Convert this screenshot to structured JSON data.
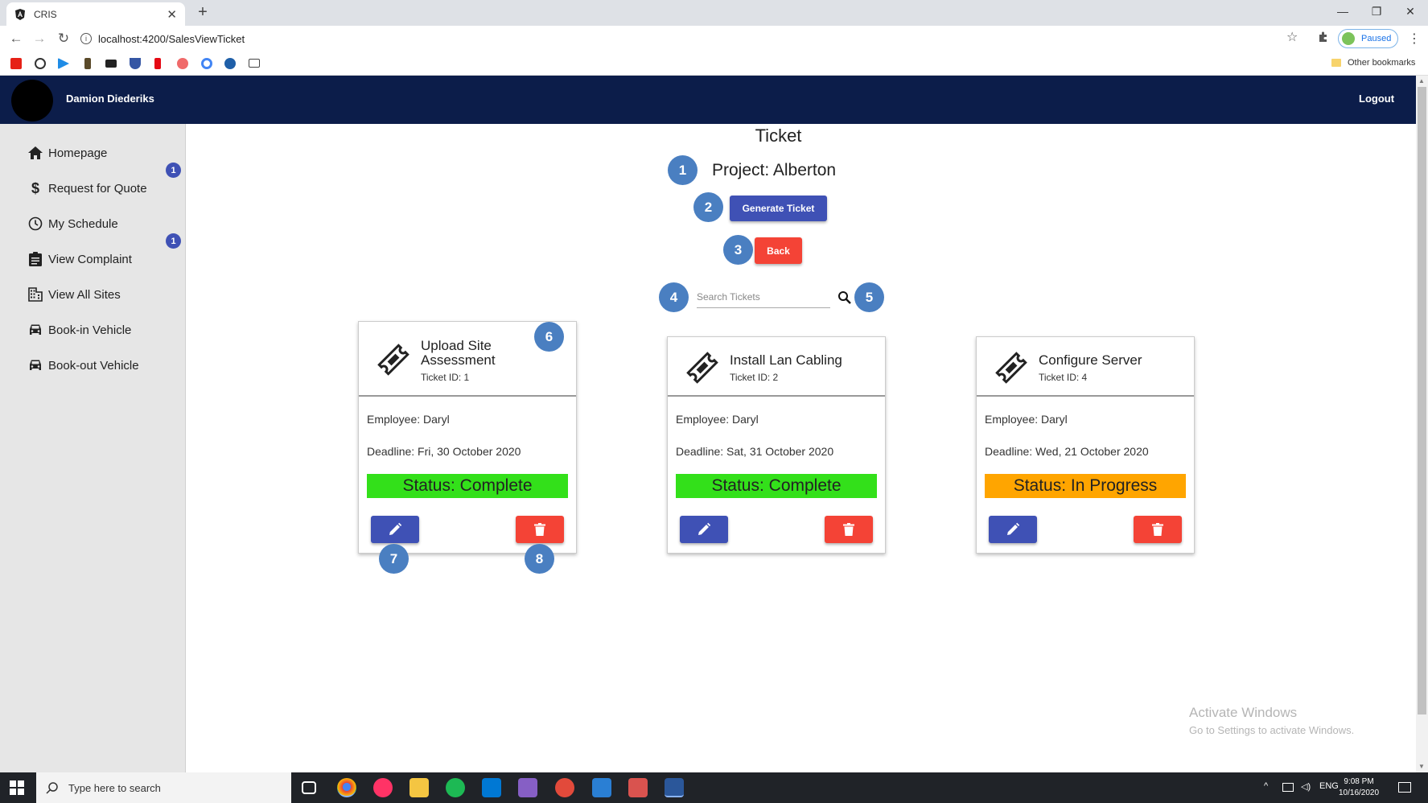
{
  "browser": {
    "tab_title": "CRIS",
    "tab_close": "✕",
    "new_tab": "+",
    "url": "localhost:4200/SalesViewTicket",
    "profile_status": "Paused",
    "other_bookmarks": "Other bookmarks",
    "bookmark_icons": [
      "youtube-icon",
      "speedometer-icon",
      "play-icon",
      "tree-icon",
      "imdb-icon",
      "shield-icon",
      "netflix-icon",
      "asana-icon",
      "google-icon",
      "sphere-icon",
      "lr-icon"
    ],
    "window_controls": [
      "—",
      "❐",
      "✕"
    ]
  },
  "header": {
    "user_name": "Damion Diederiks",
    "logout_label": "Logout"
  },
  "sidebar": {
    "items": [
      {
        "label": "Homepage",
        "icon": "home-icon"
      },
      {
        "label": "Request for Quote",
        "icon": "dollar-icon"
      },
      {
        "label": "My Schedule",
        "icon": "clock-icon"
      },
      {
        "label": "View Complaint",
        "icon": "clipboard-icon"
      },
      {
        "label": "View All Sites",
        "icon": "building-icon"
      },
      {
        "label": "Book-in Vehicle",
        "icon": "car-icon"
      },
      {
        "label": "Book-out Vehicle",
        "icon": "car-icon"
      }
    ],
    "badges": [
      "1",
      "1"
    ]
  },
  "main": {
    "title": "Ticket",
    "project": "Project: Alberton",
    "generate_label": "Generate Ticket",
    "back_label": "Back",
    "search_placeholder": "Search Tickets",
    "steps": [
      "1",
      "2",
      "3",
      "4",
      "5",
      "6",
      "7",
      "8"
    ],
    "cards": [
      {
        "title": "Upload Site Assessment",
        "ticket_id": "Ticket ID: 1",
        "employee": "Employee: Daryl",
        "deadline": "Deadline: Fri, 30 October 2020",
        "status": "Status: Complete",
        "status_color": "#33e01a"
      },
      {
        "title": "Install Lan Cabling",
        "ticket_id": "Ticket ID: 2",
        "employee": "Employee: Daryl",
        "deadline": "Deadline: Sat, 31 October 2020",
        "status": "Status: Complete",
        "status_color": "#33e01a"
      },
      {
        "title": "Configure Server",
        "ticket_id": "Ticket ID: 4",
        "employee": "Employee: Daryl",
        "deadline": "Deadline: Wed, 21 October 2020",
        "status": "Status: In Progress",
        "status_color": "#ffa500"
      }
    ]
  },
  "watermark": {
    "line1": "Activate Windows",
    "line2": "Go to Settings to activate Windows."
  },
  "taskbar": {
    "search_placeholder": "Type here to search",
    "lang": "ENG",
    "time": "9:08 PM",
    "date": "10/16/2020",
    "apps": [
      "task-view-icon",
      "chrome-icon",
      "itunes-icon",
      "file-explorer-icon",
      "spotify-icon",
      "vscode-icon",
      "visual-studio-icon",
      "mail-icon",
      "photos-icon",
      "snipping-icon",
      "word-icon"
    ]
  },
  "colors": {
    "header_bg": "#0c1d4a",
    "primary": "#3f51b5",
    "danger": "#f44336",
    "step": "#4a7fc1"
  }
}
